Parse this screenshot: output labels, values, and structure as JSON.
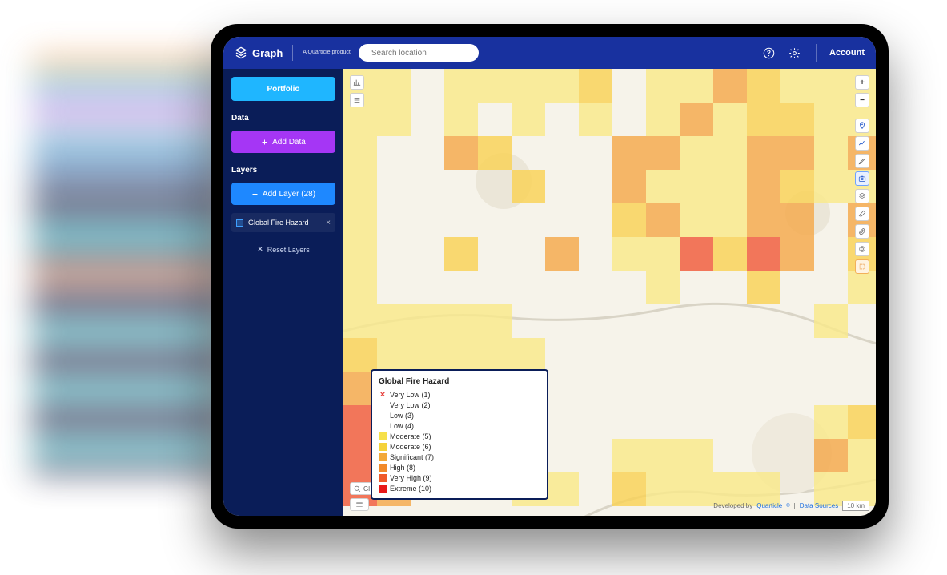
{
  "brand": {
    "name": "Graph",
    "tagline": "A Quarticle product"
  },
  "search": {
    "placeholder": "Search location"
  },
  "topbar": {
    "account": "Account"
  },
  "sidebar": {
    "portfolio": "Portfolio",
    "data_header": "Data",
    "add_data": "Add Data",
    "layers_header": "Layers",
    "add_layer": "Add Layer (28)",
    "layer_item": "Global Fire Hazard",
    "reset": "Reset Layers"
  },
  "legend": {
    "title": "Global Fire Hazard",
    "rows": [
      {
        "label": "Very Low (1)",
        "color": "",
        "crossed": true
      },
      {
        "label": "Very Low (2)",
        "color": ""
      },
      {
        "label": "Low (3)",
        "color": ""
      },
      {
        "label": "Low (4)",
        "color": ""
      },
      {
        "label": "Moderate (5)",
        "color": "#f6e04a"
      },
      {
        "label": "Moderate (6)",
        "color": "#f5d23a"
      },
      {
        "label": "Significant (7)",
        "color": "#f3a93a"
      },
      {
        "label": "High (8)",
        "color": "#f28a2a"
      },
      {
        "label": "Very High (9)",
        "color": "#f05a2a"
      },
      {
        "label": "Extreme (10)",
        "color": "#e81919"
      }
    ]
  },
  "attribution": {
    "developed_by": "Developed by ",
    "brand_link": "Quarticle",
    "divider": " | ",
    "sources": "Data Sources",
    "scale": "10 km"
  },
  "heat_cells": [
    [
      0,
      0,
      "#f9e98a"
    ],
    [
      1,
      0,
      "#f9e98a"
    ],
    [
      3,
      0,
      "#f9e98a"
    ],
    [
      4,
      0,
      "#f9e98a"
    ],
    [
      5,
      0,
      "#f9e98a"
    ],
    [
      6,
      0,
      "#f9e98a"
    ],
    [
      7,
      0,
      "#f9d255"
    ],
    [
      9,
      0,
      "#f9e98a"
    ],
    [
      10,
      0,
      "#f9e98a"
    ],
    [
      11,
      0,
      "#f4a84a"
    ],
    [
      12,
      0,
      "#f9d255"
    ],
    [
      13,
      0,
      "#f9e98a"
    ],
    [
      14,
      0,
      "#f9e98a"
    ],
    [
      15,
      0,
      "#f9e98a"
    ],
    [
      0,
      1,
      "#f9e98a"
    ],
    [
      1,
      1,
      "#f9e98a"
    ],
    [
      3,
      1,
      "#f9e98a"
    ],
    [
      5,
      1,
      "#f9e98a"
    ],
    [
      7,
      1,
      "#f9e98a"
    ],
    [
      9,
      1,
      "#f9e98a"
    ],
    [
      10,
      1,
      "#f4a84a"
    ],
    [
      11,
      1,
      "#f9e98a"
    ],
    [
      12,
      1,
      "#f9d255"
    ],
    [
      13,
      1,
      "#f9d255"
    ],
    [
      14,
      1,
      "#f9e98a"
    ],
    [
      15,
      1,
      "#f9e98a"
    ],
    [
      0,
      2,
      "#f9e98a"
    ],
    [
      3,
      2,
      "#f4a84a"
    ],
    [
      4,
      2,
      "#f9d255"
    ],
    [
      8,
      2,
      "#f4a84a"
    ],
    [
      9,
      2,
      "#f4a84a"
    ],
    [
      10,
      2,
      "#f9e98a"
    ],
    [
      11,
      2,
      "#f9e98a"
    ],
    [
      12,
      2,
      "#f4a84a"
    ],
    [
      13,
      2,
      "#f4a84a"
    ],
    [
      14,
      2,
      "#f9e98a"
    ],
    [
      15,
      2,
      "#f4a84a"
    ],
    [
      0,
      3,
      "#f9e98a"
    ],
    [
      5,
      3,
      "#f9d255"
    ],
    [
      8,
      3,
      "#f4a84a"
    ],
    [
      9,
      3,
      "#f9e98a"
    ],
    [
      10,
      3,
      "#f9e98a"
    ],
    [
      11,
      3,
      "#f9e98a"
    ],
    [
      12,
      3,
      "#f4a84a"
    ],
    [
      13,
      3,
      "#f9d255"
    ],
    [
      14,
      3,
      "#f9e98a"
    ],
    [
      15,
      3,
      "#f9e98a"
    ],
    [
      0,
      4,
      "#f9e98a"
    ],
    [
      8,
      4,
      "#f9d255"
    ],
    [
      9,
      4,
      "#f4a84a"
    ],
    [
      10,
      4,
      "#f9e98a"
    ],
    [
      11,
      4,
      "#f9e98a"
    ],
    [
      12,
      4,
      "#f4a84a"
    ],
    [
      13,
      4,
      "#f4a84a"
    ],
    [
      15,
      4,
      "#f4a84a"
    ],
    [
      0,
      5,
      "#f9e98a"
    ],
    [
      3,
      5,
      "#f9d255"
    ],
    [
      6,
      5,
      "#f4a84a"
    ],
    [
      8,
      5,
      "#f9e98a"
    ],
    [
      9,
      5,
      "#f9e98a"
    ],
    [
      10,
      5,
      "#f05a3a"
    ],
    [
      11,
      5,
      "#f9d255"
    ],
    [
      12,
      5,
      "#f05a3a"
    ],
    [
      13,
      5,
      "#f4a84a"
    ],
    [
      15,
      5,
      "#f9d255"
    ],
    [
      0,
      6,
      "#f9e98a"
    ],
    [
      9,
      6,
      "#f9e98a"
    ],
    [
      12,
      6,
      "#f9d255"
    ],
    [
      15,
      6,
      "#f9e98a"
    ],
    [
      0,
      7,
      "#f9e98a"
    ],
    [
      1,
      7,
      "#f9e98a"
    ],
    [
      2,
      7,
      "#f9e98a"
    ],
    [
      3,
      7,
      "#f9e98a"
    ],
    [
      4,
      7,
      "#f9e98a"
    ],
    [
      14,
      7,
      "#f9e98a"
    ],
    [
      0,
      8,
      "#f9d255"
    ],
    [
      1,
      8,
      "#f9e98a"
    ],
    [
      2,
      8,
      "#f9e98a"
    ],
    [
      3,
      8,
      "#f9e98a"
    ],
    [
      4,
      8,
      "#f9e98a"
    ],
    [
      5,
      8,
      "#f9e98a"
    ],
    [
      0,
      9,
      "#f4a84a"
    ],
    [
      1,
      9,
      "#f05a3a"
    ],
    [
      2,
      9,
      "#f05a3a"
    ],
    [
      3,
      9,
      "#f4a84a"
    ],
    [
      4,
      9,
      "#f9e98a"
    ],
    [
      5,
      9,
      "#f9e98a"
    ],
    [
      0,
      10,
      "#f05a3a"
    ],
    [
      1,
      10,
      "#e81919"
    ],
    [
      2,
      10,
      "#f05a3a"
    ],
    [
      4,
      10,
      "#f9e98a"
    ],
    [
      5,
      10,
      "#f9e98a"
    ],
    [
      14,
      10,
      "#f9e98a"
    ],
    [
      15,
      10,
      "#f9d255"
    ],
    [
      0,
      11,
      "#f05a3a"
    ],
    [
      1,
      11,
      "#f05a3a"
    ],
    [
      5,
      11,
      "#f9e98a"
    ],
    [
      8,
      11,
      "#f9e98a"
    ],
    [
      9,
      11,
      "#f9e98a"
    ],
    [
      10,
      11,
      "#f9e98a"
    ],
    [
      14,
      11,
      "#f4a84a"
    ],
    [
      15,
      11,
      "#f9e98a"
    ],
    [
      0,
      12,
      "#f05a3a"
    ],
    [
      1,
      12,
      "#f4a84a"
    ],
    [
      5,
      12,
      "#f9e98a"
    ],
    [
      6,
      12,
      "#f9e98a"
    ],
    [
      8,
      12,
      "#f9d255"
    ],
    [
      9,
      12,
      "#f9e98a"
    ],
    [
      10,
      12,
      "#f9e98a"
    ],
    [
      11,
      12,
      "#f9e98a"
    ],
    [
      12,
      12,
      "#f9e98a"
    ],
    [
      14,
      12,
      "#f9e98a"
    ],
    [
      15,
      12,
      "#f9e98a"
    ]
  ]
}
